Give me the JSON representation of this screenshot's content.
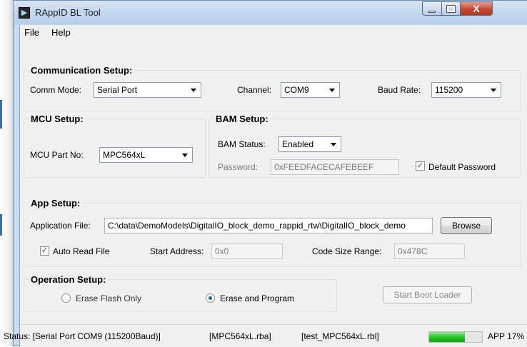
{
  "window": {
    "title": "RAppID BL Tool",
    "icon": "app-icon",
    "controls": {
      "minimize": "minimize-icon",
      "maximize": "maximize-icon",
      "close": "close-icon",
      "close_glyph": "X"
    }
  },
  "menu": {
    "file": "File",
    "help": "Help"
  },
  "communication": {
    "title": "Communication Setup:",
    "comm_mode_label": "Comm Mode:",
    "comm_mode_value": "Serial Port",
    "channel_label": "Channel:",
    "channel_value": "COM9",
    "baud_label": "Baud Rate:",
    "baud_value": "115200"
  },
  "mcu": {
    "title": "MCU Setup:",
    "part_label": "MCU Part No:",
    "part_value": "MPC564xL"
  },
  "bam": {
    "title": "BAM Setup:",
    "status_label": "BAM Status:",
    "status_value": "Enabled",
    "password_label": "Password:",
    "password_value": "0xFEEDFACECAFEBEEF",
    "default_password_label": "Default Password",
    "default_password_checked": true
  },
  "app": {
    "title": "App Setup:",
    "file_label": "Application File:",
    "file_value": "C:\\data\\DemoModels\\DigitalIO_block_demo_rappid_rtw\\DigitalIO_block_demo",
    "browse_label": "Browse",
    "auto_read_label": "Auto Read File",
    "auto_read_checked": true,
    "start_address_label": "Start Address:",
    "start_address_value": "0x0",
    "code_size_label": "Code Size Range:",
    "code_size_value": "0x478C"
  },
  "operation": {
    "title": "Operation Setup:",
    "erase_only_label": "Erase Flash Only",
    "erase_program_label": "Erase and Program",
    "selected": "Erase and Program",
    "start_label": "Start Boot Loader"
  },
  "status": {
    "port": "Status: [Serial Port COM9 (115200Baud)]",
    "rba": "[MPC564xL.rba]",
    "rbl": "[test_MPC564xL.rbl]",
    "progress_percent": 17,
    "progress_label": "APP 17%",
    "progress_color": "#27c52a"
  },
  "colors": {
    "titlebar": "#c3d7ee",
    "close_button": "#c64a33",
    "background": "#f0f0f0"
  }
}
